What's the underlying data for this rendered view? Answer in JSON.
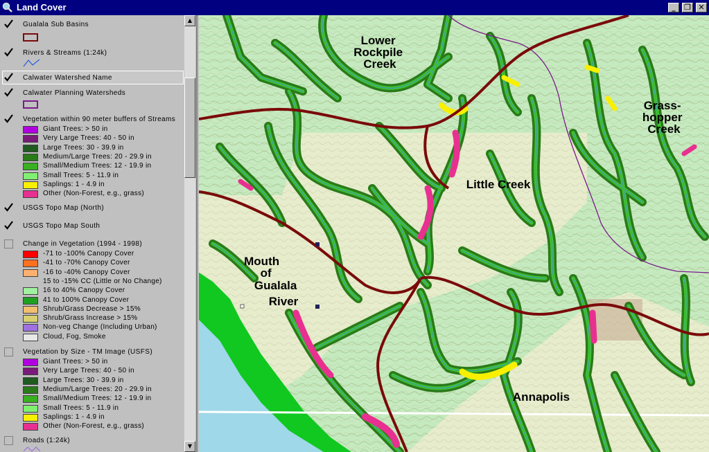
{
  "window": {
    "title": "Land Cover",
    "buttons": [
      "_",
      "❐",
      "✕"
    ]
  },
  "legend": {
    "layers": [
      {
        "name": "Gualala Sub Basins",
        "checked": true
      },
      {
        "name": "Rivers & Streams (1:24k)",
        "checked": true
      },
      {
        "name": "Calwater Watershed Name",
        "checked": true
      },
      {
        "name": "Calwater Planning Watersheds",
        "checked": true
      },
      {
        "name": "Vegetation within 90 meter buffers of Streams",
        "checked": true,
        "classes": [
          {
            "label": "Giant Trees: > 50 in",
            "color": "#b000e0"
          },
          {
            "label": "Very Large Trees: 40 - 50 in",
            "color": "#7a1a7a"
          },
          {
            "label": "Large Trees: 30 - 39.9 in",
            "color": "#1f5a1f"
          },
          {
            "label": "Medium/Large Trees: 20 - 29.9 in",
            "color": "#2a7a1a"
          },
          {
            "label": "Small/Medium Trees: 12 - 19.9 in",
            "color": "#38b020"
          },
          {
            "label": "Small Trees: 5 - 11.9 in",
            "color": "#80f070"
          },
          {
            "label": "Saplings: 1 - 4.9 in",
            "color": "#f8f000"
          },
          {
            "label": "Other (Non-Forest, e.g., grass)",
            "color": "#e83090"
          }
        ]
      },
      {
        "name": "USGS Topo Map (North)",
        "checked": true
      },
      {
        "name": "USGS Topo Map South",
        "checked": true
      },
      {
        "name": "Change in Vegetation (1994 - 1998)",
        "checked": false,
        "classes": [
          {
            "label": "-71 to -100% Canopy Cover",
            "color": "#ff0000"
          },
          {
            "label": "-41 to -70% Canopy Cover",
            "color": "#ff7020"
          },
          {
            "label": "-16 to -40% Canopy Cover",
            "color": "#ffb070"
          },
          {
            "label": "15 to -15% CC (Little or No Change)",
            "color": ""
          },
          {
            "label": "16 to 40% Canopy Cover",
            "color": "#a0f0a0"
          },
          {
            "label": "41 to 100% Canopy Cover",
            "color": "#20a020"
          },
          {
            "label": "Shrub/Grass Decrease > 15%",
            "color": "#f0c070"
          },
          {
            "label": "Shrub/Grass Increase > 15%",
            "color": "#d8d070"
          },
          {
            "label": "Non-veg Change (Including Urban)",
            "color": "#a070e0"
          },
          {
            "label": "Cloud, Fog, Smoke",
            "color": "#e8e8e8"
          }
        ]
      },
      {
        "name": "Vegetation by Size - TM Image (USFS)",
        "checked": false,
        "classes": [
          {
            "label": "Giant Trees: > 50 in",
            "color": "#b000e0"
          },
          {
            "label": "Very Large Trees: 40 - 50 in",
            "color": "#7a1a7a"
          },
          {
            "label": "Large Trees: 30 - 39.9 in",
            "color": "#1f5a1f"
          },
          {
            "label": "Medium/Large Trees: 20 - 29.9 in",
            "color": "#2a7a1a"
          },
          {
            "label": "Small/Medium Trees: 12 - 19.9 in",
            "color": "#38b020"
          },
          {
            "label": "Small Trees: 5 - 11.9 in",
            "color": "#80f070"
          },
          {
            "label": "Saplings: 1 - 4.9 in",
            "color": "#f8f000"
          },
          {
            "label": "Other (Non-Forest, e.g., grass)",
            "color": "#e83090"
          }
        ]
      },
      {
        "name": "Roads (1:24k)",
        "checked": false
      }
    ]
  },
  "map": {
    "labels": {
      "lower_rockpile": [
        "Lower",
        "Rockpile",
        "Creek"
      ],
      "grasshopper": [
        "Grass-",
        "hopper",
        "Creek"
      ],
      "little_creek": "Little Creek",
      "mouth_gualala": [
        "Mouth",
        "of",
        "Gualala",
        "River"
      ],
      "annapolis": "Annapolis"
    },
    "colors": {
      "topo_bg": "#c6eac0",
      "topo_light": "#e6eccc",
      "ocean": "#9fd8e8",
      "land_strip": "#10c820",
      "basin_line": "#7a0a0a",
      "planning_line": "#7a1a8a",
      "stream_buffer_dark": "#2a7a1a",
      "stream_buffer_light": "#40c030"
    }
  }
}
